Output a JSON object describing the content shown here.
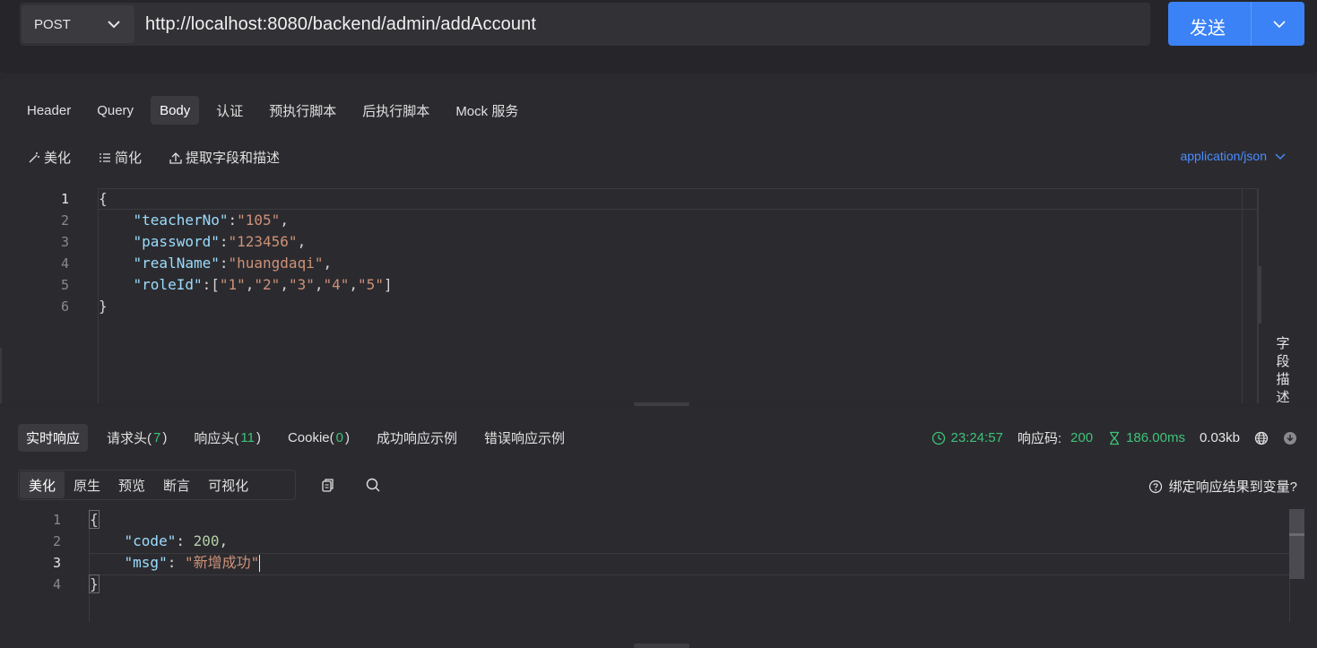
{
  "request": {
    "method": "POST",
    "url": "http://localhost:8080/backend/admin/addAccount",
    "send_label": "发送"
  },
  "request_tabs": [
    "Header",
    "Query",
    "Body",
    "认证",
    "预执行脚本",
    "后执行脚本",
    "Mock 服务"
  ],
  "active_request_tab": "Body",
  "body_tools": {
    "beautify": "美化",
    "simplify": "简化",
    "extract": "提取字段和描述",
    "content_type": "application/json"
  },
  "body_code": {
    "line_numbers": [
      "1",
      "2",
      "3",
      "4",
      "5",
      "6"
    ],
    "lines": [
      "{",
      "    \"teacherNo\":\"105\",",
      "    \"password\":\"123456\",",
      "    \"realName\":\"huangdaqi\",",
      "    \"roleId\":[\"1\",\"2\",\"3\",\"4\",\"5\"]",
      "}"
    ]
  },
  "field_desc_label": "字段描述",
  "response_tabs": {
    "realtime": "实时响应",
    "req_headers": "请求头(",
    "req_headers_count": "7",
    "resp_headers": "响应头(",
    "resp_headers_count": "11",
    "cookie": "Cookie(",
    "cookie_count": "0",
    "close_paren": ")",
    "success_example": "成功响应示例",
    "error_example": "错误响应示例"
  },
  "response_meta": {
    "time": "23:24:57",
    "status_label": "响应码:",
    "status_code": "200",
    "duration": "186.00ms",
    "size": "0.03kb"
  },
  "view_tabs": [
    "美化",
    "原生",
    "预览",
    "断言",
    "可视化"
  ],
  "active_view_tab": "美化",
  "bind_label": "绑定响应结果到变量?",
  "response_code": {
    "line_numbers": [
      "1",
      "2",
      "3",
      "4"
    ],
    "code_key": "\"code\"",
    "code_val": "200",
    "msg_key": "\"msg\"",
    "msg_val": "\"新增成功\""
  },
  "colors": {
    "accent": "#3b82f6",
    "success": "#3ec27a",
    "link": "#4a8cff",
    "background": "#2a2a2e"
  }
}
